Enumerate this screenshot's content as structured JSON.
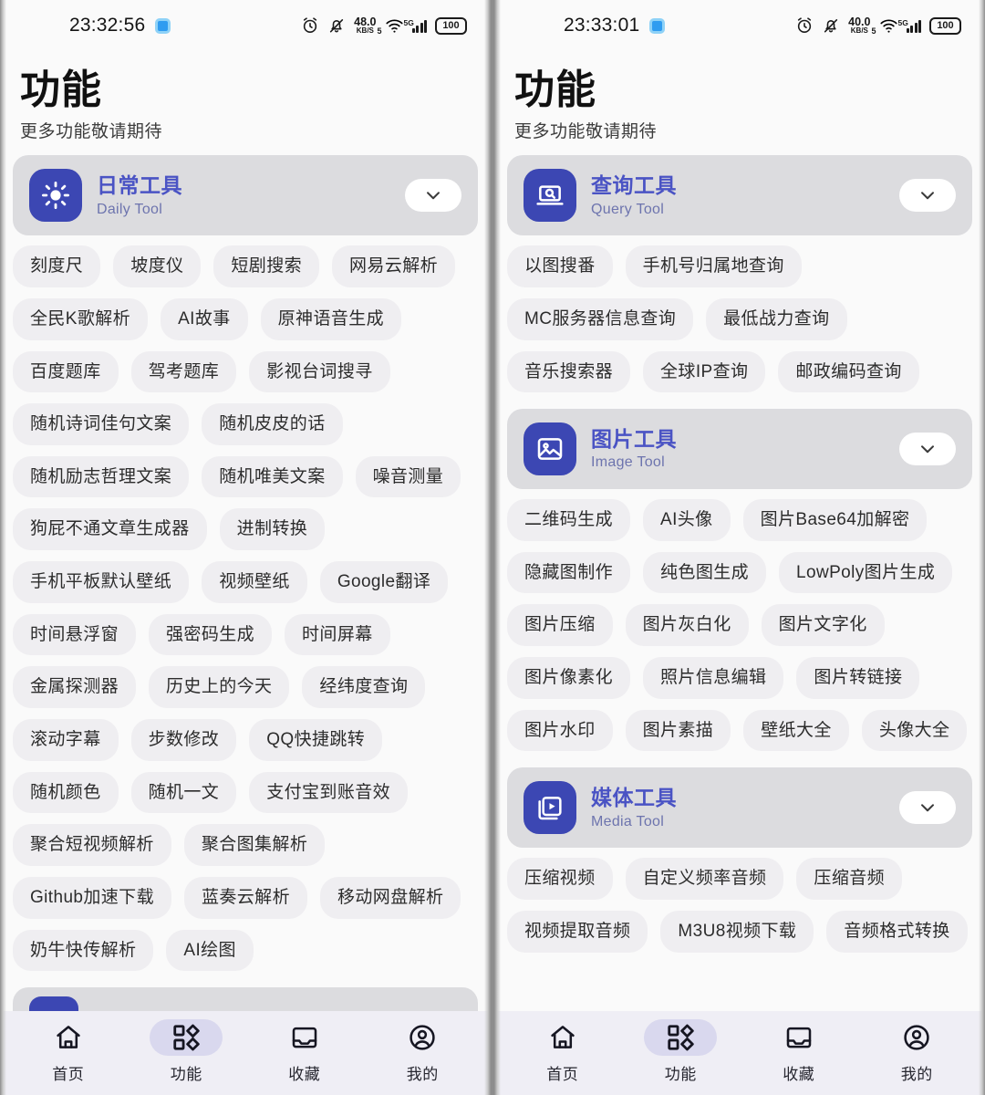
{
  "screens": [
    {
      "id": "left",
      "statusbar": {
        "clock": "23:32:56",
        "net_speed_value": "48.0",
        "net_speed_unit": "KB/S",
        "signal_gen": "5G",
        "wifi_gen": "5",
        "battery": "100"
      },
      "header": {
        "title": "功能",
        "subtitle": "更多功能敬请期待"
      },
      "categories": [
        {
          "name": "日常工具",
          "english": "Daily Tool",
          "icon": "sun-icon",
          "expanded": true,
          "rows": [
            [
              "刻度尺",
              "坡度仪",
              "短剧搜索",
              "网易云解析"
            ],
            [
              "全民K歌解析",
              "AI故事",
              "原神语音生成"
            ],
            [
              "百度题库",
              "驾考题库",
              "影视台词搜寻"
            ],
            [
              "随机诗词佳句文案",
              "随机皮皮的话"
            ],
            [
              "随机励志哲理文案",
              "随机唯美文案",
              "噪音测量"
            ],
            [
              "狗屁不通文章生成器",
              "进制转换"
            ],
            [
              "手机平板默认壁纸",
              "视频壁纸",
              "Google翻译"
            ],
            [
              "时间悬浮窗",
              "强密码生成",
              "时间屏幕"
            ],
            [
              "金属探测器",
              "历史上的今天",
              "经纬度查询"
            ],
            [
              "滚动字幕",
              "步数修改",
              "QQ快捷跳转"
            ],
            [
              "随机颜色",
              "随机一文",
              "支付宝到账音效"
            ],
            [
              "聚合短视频解析",
              "聚合图集解析"
            ],
            [
              "Github加速下载",
              "蓝奏云解析",
              "移动网盘解析"
            ],
            [
              "奶牛快传解析",
              "AI绘图"
            ]
          ]
        }
      ],
      "peek_card": true
    },
    {
      "id": "right",
      "statusbar": {
        "clock": "23:33:01",
        "net_speed_value": "40.0",
        "net_speed_unit": "KB/S",
        "signal_gen": "5G",
        "wifi_gen": "5",
        "battery": "100"
      },
      "header": {
        "title": "功能",
        "subtitle": "更多功能敬请期待"
      },
      "categories": [
        {
          "name": "查询工具",
          "english": "Query Tool",
          "icon": "laptop-search-icon",
          "expanded": true,
          "rows": [
            [
              "以图搜番",
              "手机号归属地查询"
            ],
            [
              "MC服务器信息查询",
              "最低战力查询"
            ],
            [
              "音乐搜索器",
              "全球IP查询",
              "邮政编码查询"
            ]
          ]
        },
        {
          "name": "图片工具",
          "english": "Image Tool",
          "icon": "image-icon",
          "expanded": true,
          "rows": [
            [
              "二维码生成",
              "AI头像",
              "图片Base64加解密"
            ],
            [
              "隐藏图制作",
              "纯色图生成",
              "LowPoly图片生成"
            ],
            [
              "图片压缩",
              "图片灰白化",
              "图片文字化"
            ],
            [
              "图片像素化",
              "照片信息编辑",
              "图片转链接"
            ],
            [
              "图片水印",
              "图片素描",
              "壁纸大全",
              "头像大全"
            ]
          ]
        },
        {
          "name": "媒体工具",
          "english": "Media Tool",
          "icon": "video-play-icon",
          "expanded": true,
          "rows": [
            [
              "压缩视频",
              "自定义频率音频",
              "压缩音频"
            ],
            [
              "视频提取音频",
              "M3U8视频下载",
              "音频格式转换"
            ]
          ]
        }
      ],
      "peek_card": false
    }
  ],
  "tabbar": {
    "items": [
      {
        "label": "首页",
        "icon": "home-icon",
        "active": false
      },
      {
        "label": "功能",
        "icon": "grid-apps-icon",
        "active": true
      },
      {
        "label": "收藏",
        "icon": "inbox-icon",
        "active": false
      },
      {
        "label": "我的",
        "icon": "user-circle-icon",
        "active": false
      }
    ]
  },
  "colors": {
    "accent": "#4a53c4",
    "icon_bg": "#3c47b3",
    "card_bg": "#dcdcdf",
    "chip_bg": "#efeef1",
    "tabbar_bg": "#efeef5",
    "page_bg": "#fafafa",
    "active_pill": "#d9d8ee"
  }
}
